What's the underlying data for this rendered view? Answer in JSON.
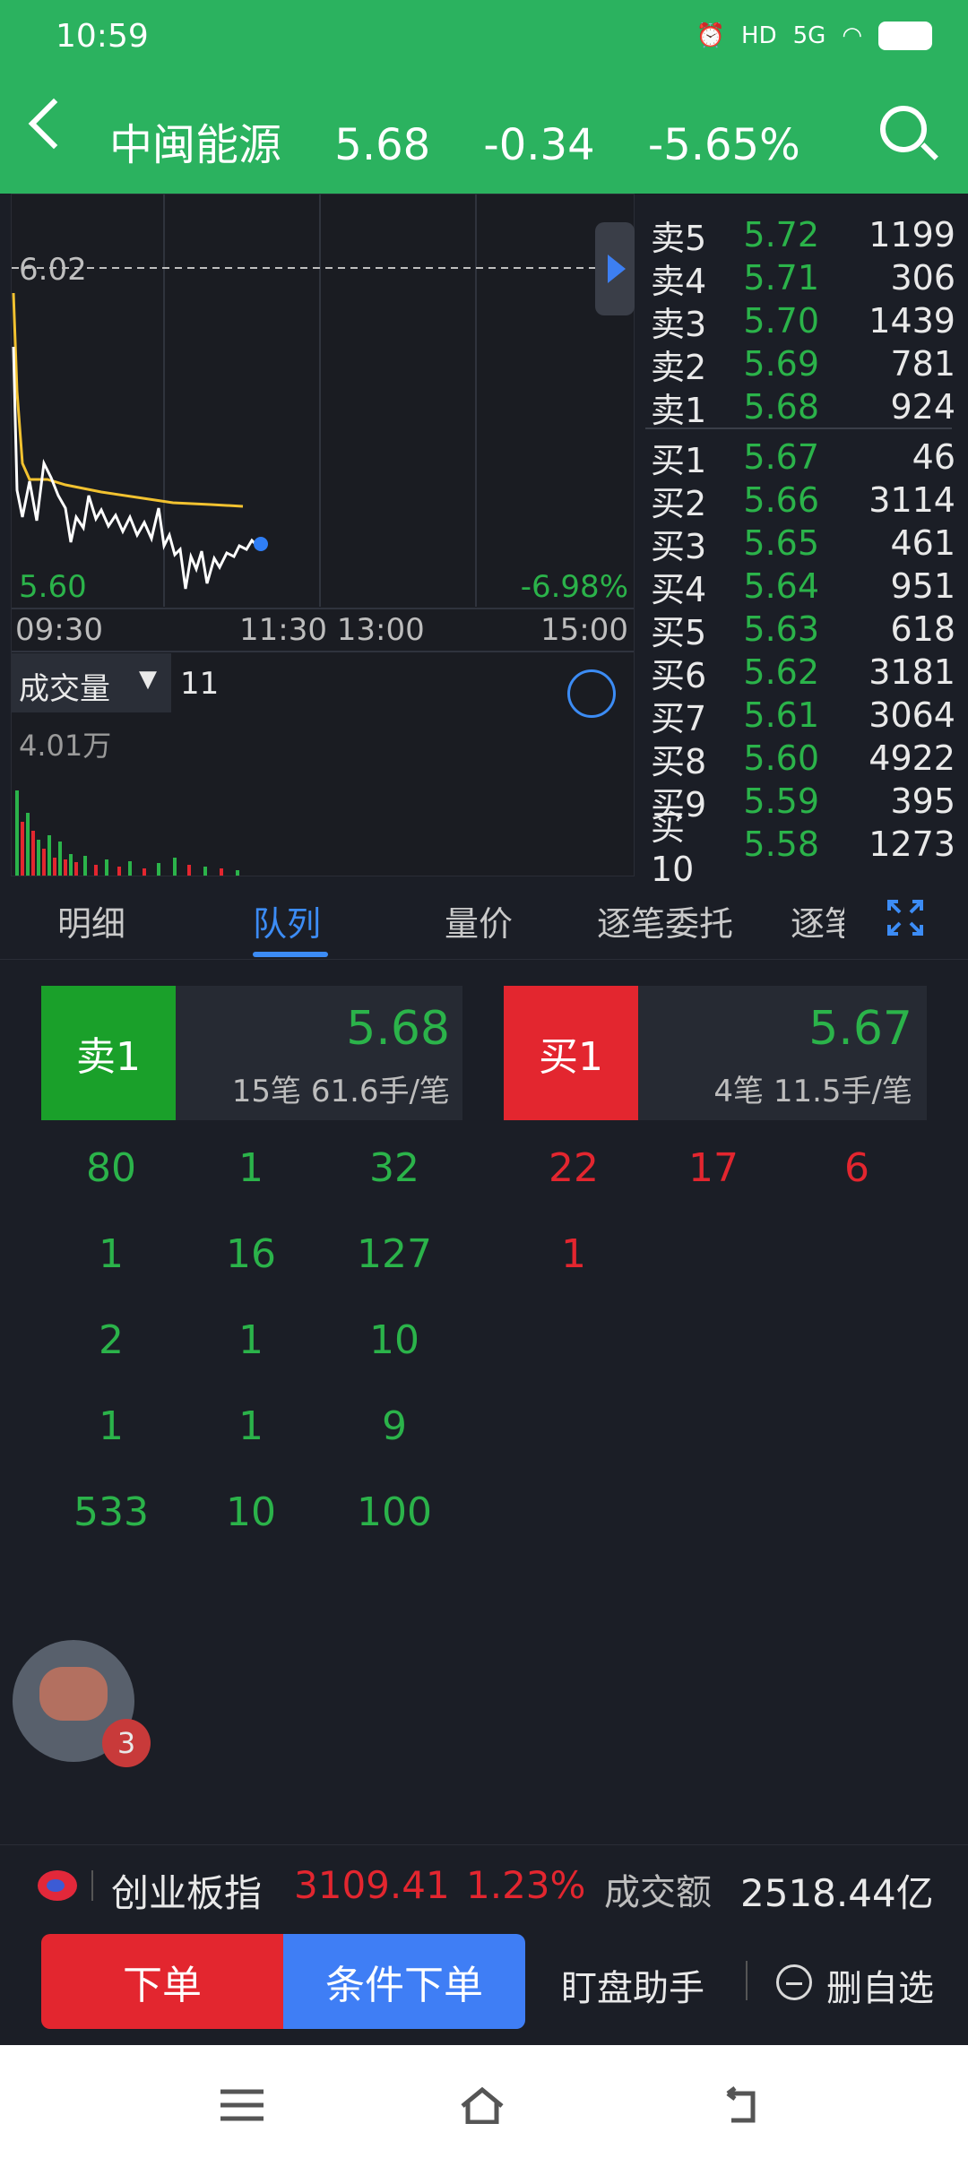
{
  "status": {
    "time": "10:59",
    "icons": [
      "alarm-icon",
      "hd-icon",
      "5g-signal-icon",
      "wifi-icon",
      "battery-icon"
    ],
    "hd": "HD",
    "net": "5G"
  },
  "header": {
    "title": "中闽能源",
    "price": "5.68",
    "change": "-0.34",
    "change_pct": "-5.65%"
  },
  "chart": {
    "ref_price": "6.02",
    "low_price": "5.60",
    "low_pct": "-6.98%",
    "time_labels": {
      "start": "09:30",
      "mid": "11:30 13:00",
      "end": "15:00"
    },
    "volume_selector": "成交量",
    "volume_value": "11",
    "volume_max": "4.01万"
  },
  "order_book": {
    "asks": [
      {
        "label": "卖5",
        "price": "5.72",
        "volume": "1199"
      },
      {
        "label": "卖4",
        "price": "5.71",
        "volume": "306"
      },
      {
        "label": "卖3",
        "price": "5.70",
        "volume": "1439"
      },
      {
        "label": "卖2",
        "price": "5.69",
        "volume": "781"
      },
      {
        "label": "卖1",
        "price": "5.68",
        "volume": "924"
      }
    ],
    "bids": [
      {
        "label": "买1",
        "price": "5.67",
        "volume": "46"
      },
      {
        "label": "买2",
        "price": "5.66",
        "volume": "3114"
      },
      {
        "label": "买3",
        "price": "5.65",
        "volume": "461"
      },
      {
        "label": "买4",
        "price": "5.64",
        "volume": "951"
      },
      {
        "label": "买5",
        "price": "5.63",
        "volume": "618"
      },
      {
        "label": "买6",
        "price": "5.62",
        "volume": "3181"
      },
      {
        "label": "买7",
        "price": "5.61",
        "volume": "3064"
      },
      {
        "label": "买8",
        "price": "5.60",
        "volume": "4922"
      },
      {
        "label": "买9",
        "price": "5.59",
        "volume": "395"
      },
      {
        "label": "买10",
        "price": "5.58",
        "volume": "1273"
      }
    ]
  },
  "tabs": [
    "明细",
    "队列",
    "量价",
    "逐笔委托",
    "逐笔"
  ],
  "active_tab": "队列",
  "queue": {
    "sell": {
      "label": "卖1",
      "price": "5.68",
      "sub": "15笔 61.6手/笔",
      "cells": [
        "80",
        "1",
        "32",
        "1",
        "16",
        "127",
        "2",
        "1",
        "10",
        "1",
        "1",
        "9",
        "533",
        "10",
        "100"
      ]
    },
    "buy": {
      "label": "买1",
      "price": "5.67",
      "sub": "4笔 11.5手/笔",
      "cells": [
        "22",
        "17",
        "6",
        "1"
      ]
    }
  },
  "assistant": {
    "badge": "3"
  },
  "index_bar": {
    "name": "创业板指",
    "value": "3109.41",
    "pct": "1.23%",
    "turnover_label": "成交额",
    "turnover": "2518.44亿"
  },
  "actions": {
    "order": "下单",
    "conditional": "条件下单",
    "monitor": "盯盘助手",
    "remove": "删自选"
  },
  "colors": {
    "green": "#2bb34a",
    "red": "#e3262f",
    "blue": "#3f7ef5",
    "header": "#2bb25f"
  }
}
